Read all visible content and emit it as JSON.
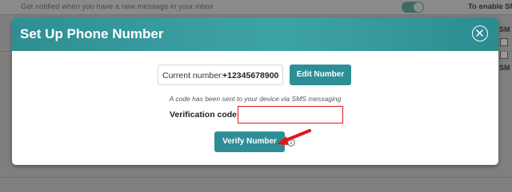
{
  "background": {
    "notice_text": "Get notified when you have a new message in your inbox",
    "enable_text": "To enable SMS",
    "right_frags": [
      "SM",
      "SM"
    ]
  },
  "modal": {
    "title": "Set Up Phone Number",
    "close_icon": "close-icon",
    "current_label": "Current number:",
    "current_value": "+12345678900",
    "edit_button": "Edit Number",
    "sms_note": "A code has been sent to your device via SMS messaging",
    "code_label": "Verification code:",
    "code_value": "",
    "verify_button": "Verify Number",
    "info_icon": "info-icon"
  },
  "colors": {
    "header_teal": "#3ea3a7",
    "button_teal": "#2e8e95",
    "input_border_highlight": "#e01818",
    "annotation_arrow": "#e01818"
  }
}
